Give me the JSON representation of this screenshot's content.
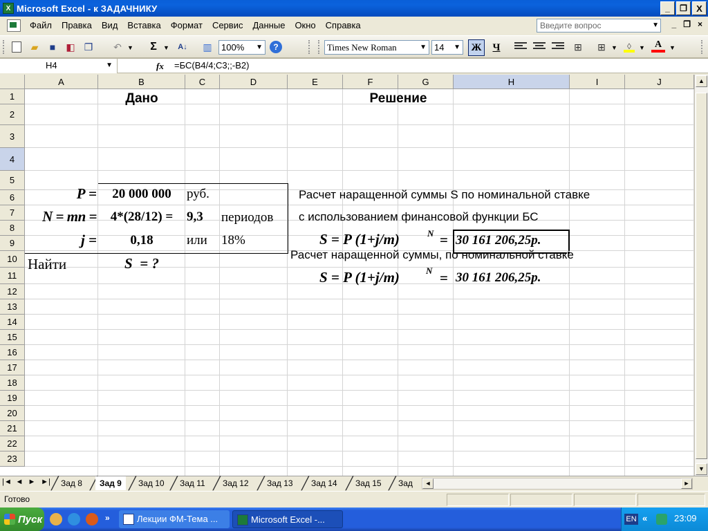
{
  "window": {
    "title": "Microsoft Excel - к ЗАДАЧНИКУ",
    "app_icon": "X",
    "btn_min": "_",
    "btn_max": "❐",
    "btn_close": "X"
  },
  "menu": {
    "items": [
      "Файл",
      "Правка",
      "Вид",
      "Вставка",
      "Формат",
      "Сервис",
      "Данные",
      "Окно",
      "Справка"
    ],
    "help_placeholder": "Введите вопрос",
    "doc_min": "_",
    "doc_restore": "❐",
    "doc_close": "×"
  },
  "toolbar": {
    "zoom": "100%",
    "font": "Times New Roman",
    "size": "14",
    "bold": "Ж",
    "underline": "Ч",
    "sigma": "Σ",
    "sort": "А↓",
    "undo": "↶",
    "help": "?",
    "font_color_glyph": "A",
    "colors": {
      "fill": "#ffff00",
      "font": "#ff0000",
      "selected_btn": "#c1d2ee"
    }
  },
  "formula_bar": {
    "name_box": "H4",
    "fx": "fx",
    "formula": "=БС(B4/4;C3;;-B2)"
  },
  "grid": {
    "columns": [
      "A",
      "B",
      "C",
      "D",
      "E",
      "F",
      "G",
      "H",
      "I",
      "J"
    ],
    "selected_column": "H",
    "rows": [
      "1",
      "2",
      "3",
      "4",
      "5",
      "6",
      "7",
      "8",
      "9",
      "10",
      "11",
      "12",
      "13",
      "14",
      "15",
      "16",
      "17",
      "18",
      "19",
      "20",
      "21",
      "22",
      "23"
    ],
    "selected_row": "4",
    "cells": {
      "B1": "Дано",
      "A2": "P =",
      "B2": "20 000 000",
      "C2": "руб.",
      "A3": "N = mn =",
      "B3": "4*(28/12) =",
      "C3": "9,3",
      "D3": "периодов",
      "A4": "j =",
      "B4": "0,18",
      "C4": "или",
      "D4": "18%",
      "A5": "Найти",
      "B5": "S  = ?",
      "F1": "Решение",
      "E2": "Расчет наращенной суммы S по номинальной ставке",
      "E3": "с использованием финансовой функции БС",
      "E4_formula": "S = P (1+j/m)",
      "E4_sup": "N",
      "E4_eq": "=",
      "H4": "30 161 206,25р.",
      "E9": "Расчет наращенной суммы, по номинальной ставке",
      "E10_formula": "S = P (1+j/m)",
      "E10_sup": "N",
      "E10_eq": "=",
      "H10": "30 161 206,25р."
    }
  },
  "sheet_tabs": {
    "nav": [
      "|◄",
      "◄",
      "►",
      "►|"
    ],
    "tabs": [
      "Зад 8",
      "Зад 9",
      "Зад 10",
      "Зад 11",
      "Зад 12",
      "Зад 13",
      "Зад 14",
      "Зад 15",
      "Зад"
    ],
    "active": "Зад 9"
  },
  "status": {
    "text": "Готово"
  },
  "taskbar": {
    "start": "Пуск",
    "tasks": [
      "Лекции ФМ-Тема ...",
      "Microsoft Excel -..."
    ],
    "lang": "EN",
    "chevron": "«",
    "clock": "23:09"
  }
}
